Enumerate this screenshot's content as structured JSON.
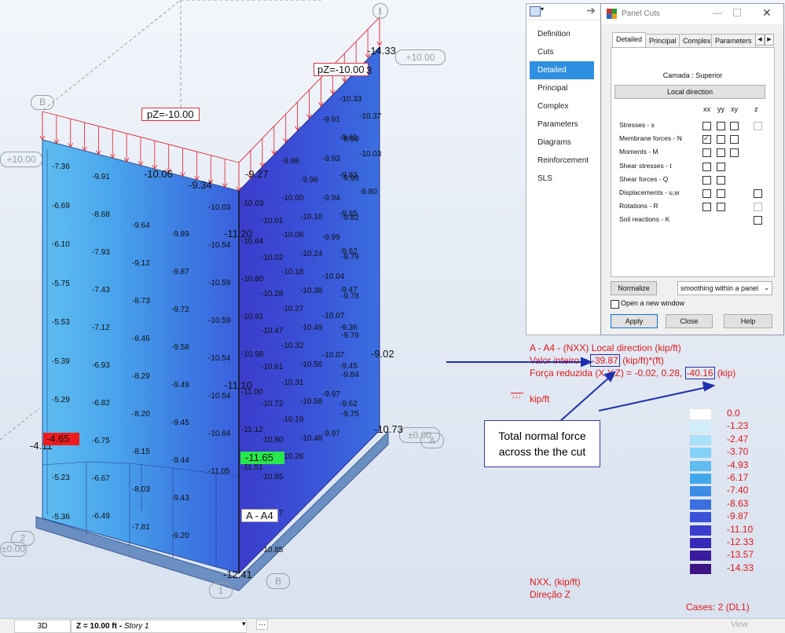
{
  "model": {
    "loads": {
      "pz_left": "pZ=-10.00",
      "pz_right": "pZ=-10.00",
      "top_value": "-14.33",
      "top_suffix": "3"
    },
    "grid_labels": {
      "g1_top": "1",
      "gB_left": "B",
      "gplus10_left": "+10.00",
      "gplus10_right": "+10.00",
      "g0_right": "±0.00",
      "gA_right": "A",
      "g2_left": "2",
      "g0_left": "±0.00",
      "g1_bottom": "1",
      "gB_bottom": "B"
    },
    "left_panel_values": {
      "col1": [
        "-7.36",
        "-6.69",
        "-6.10",
        "-5.75",
        "-5.53",
        "-5.39",
        "-5.29",
        "-4.65",
        "-5.23",
        "-5.36"
      ],
      "col2": [
        "-9.91",
        "-8.68",
        "-7.93",
        "-7.43",
        "-7.12",
        "-6.93",
        "-6.82",
        "-6.75",
        "-6.67",
        "-6.49"
      ],
      "col3": [
        "-9.64",
        "-9.12",
        "-8.73",
        "-8.46",
        "-8.29",
        "-8.20",
        "-8.15",
        "-8.03",
        "-7.81"
      ],
      "col4": [
        "-9.89",
        "-9.87",
        "-9.72",
        "-9.58",
        "-9.49",
        "-9.45",
        "-9.44",
        "-9.43",
        "-9.20"
      ],
      "col5": [
        "-10.03",
        "-10.54",
        "-10.59",
        "-10.59",
        "-10.54",
        "-10.54",
        "-10.64",
        "-11.05"
      ]
    },
    "left_extra": {
      "edge_411": "-4.11",
      "top_1006": "-10.06",
      "top_934": "-9.34",
      "min_red": "-4.65"
    },
    "right_panel_values": {
      "col1": [
        "-10.03",
        "-10.64",
        "-10.80",
        "-10.91",
        "-10.98",
        "-11.00",
        "-11.12",
        "-11.51"
      ],
      "col2": [
        "-10.01",
        "-10.02",
        "-10.28",
        "-10.47",
        "-10.61",
        "-10.72",
        "-10.80",
        "-10.85",
        "-10.87",
        "-10.85"
      ],
      "col3": [
        "-9.98",
        "-9.96",
        "-10.00",
        "-10.10",
        "-10.08",
        "-10.24",
        "-10.18",
        "-10.38",
        "-10.27",
        "-10.49",
        "-10.32",
        "-10.56",
        "-10.31",
        "-10.58",
        "-10.19",
        "-10.48",
        "-10.26"
      ],
      "col4": [
        "-9.91",
        "-9.99",
        "-9.93",
        "-9.90",
        "-9.94",
        "-9.82",
        "-9.99",
        "-9.79",
        "-10.04",
        "-9.78",
        "-10.07",
        "-9.79",
        "-10.07",
        "-9.84",
        "-9.97",
        "-9.75",
        "-9.97"
      ],
      "col5": [
        "-10.33",
        "-9.61",
        "-9.83",
        "-9.85",
        "-9.62",
        "-9.47",
        "-9.36",
        "-9.45",
        "-9.62"
      ],
      "col6": [
        "-10.37",
        "-10.03",
        "-9.80"
      ]
    },
    "right_extra": {
      "top_927": "-9.27",
      "mid_1120": "-11.20",
      "mid_1110": "-11.10",
      "max_green": "-11.65",
      "right_902": "-9.02",
      "right_1073": "-10.73",
      "bottom_1241": "-12.41"
    },
    "cut_label": "A - A4"
  },
  "side_menu": {
    "items": [
      "Definition",
      "Cuts",
      "Detailed",
      "Principal",
      "Complex",
      "Parameters",
      "Diagrams",
      "Reinforcement",
      "SLS"
    ],
    "selected": "Detailed"
  },
  "dialog": {
    "title": "Panel Cuts",
    "tabs": [
      "Detailed",
      "Principal",
      "Complex",
      "Parameters"
    ],
    "active_tab": "Detailed",
    "layer_label": "Camada : Superior",
    "local_direction_button": "Local direction",
    "columns": [
      "xx",
      "yy",
      "xy",
      "z"
    ],
    "rows": [
      {
        "label": "Stresses - s",
        "boxes": [
          "off",
          "off",
          "off",
          "disabled"
        ]
      },
      {
        "label": "Membrane forces - N",
        "boxes": [
          "on",
          "off",
          "off",
          null
        ]
      },
      {
        "label": "Moments - M",
        "boxes": [
          "off",
          "off",
          "off",
          null
        ]
      },
      {
        "label": "Shear stresses - t",
        "boxes": [
          "off",
          "off",
          null,
          null
        ]
      },
      {
        "label": "Shear forces - Q",
        "boxes": [
          "off",
          "off",
          null,
          null
        ]
      },
      {
        "label": "Displacements - u,w",
        "boxes": [
          "off",
          "off",
          null,
          "off"
        ]
      },
      {
        "label": "Rotations - R",
        "boxes": [
          "off",
          "off",
          null,
          "disabled"
        ]
      },
      {
        "label": "Soil reactions - K",
        "boxes": [
          null,
          null,
          null,
          "off"
        ]
      }
    ],
    "normalize_button": "Normalize",
    "smoothing_select": "smoothing within a panel",
    "open_new_window": "Open a new window",
    "apply_button": "Apply",
    "close_button": "Close",
    "help_button": "Help"
  },
  "result_info": {
    "line1": "A - A4 - (NXX) Local direction (kip/ft)",
    "line2_pre": "Valor inteiro = ",
    "line2_val": "-39.87",
    "line2_post": " (kip/ft)*(ft)",
    "line3_pre": "Força reduzida (X,Y,Z) = -0.02, 0.28, ",
    "line3_val": "-40.16",
    "line3_post": " (kip)",
    "unit": "kip/ft"
  },
  "callout": {
    "line1": "Total normal force",
    "line2": "across the the cut"
  },
  "legend": {
    "values": [
      "0.0",
      "-1.23",
      "-2.47",
      "-3.70",
      "-4.93",
      "-6.17",
      "-7.40",
      "-8.63",
      "-9.87",
      "-11.10",
      "-12.33",
      "-13.57",
      "-14.33"
    ],
    "colors": [
      "#ffffff",
      "#cfeffb",
      "#a9e1f8",
      "#84d1f6",
      "#5fbdf1",
      "#41a8ec",
      "#3d8de6",
      "#3a6fe0",
      "#3a52d8",
      "#3b3ccc",
      "#3929b7",
      "#3b1c9f",
      "#3e1383"
    ]
  },
  "footer_text": {
    "quantity": "NXX, (kip/ft)",
    "direction": "Direção Z",
    "cases": "Cases: 2 (DL1)"
  },
  "statusbar": {
    "view": "3D",
    "z_label": "Z = 10.00 ft - ",
    "story": "Story 1",
    "view_btn": "View"
  }
}
